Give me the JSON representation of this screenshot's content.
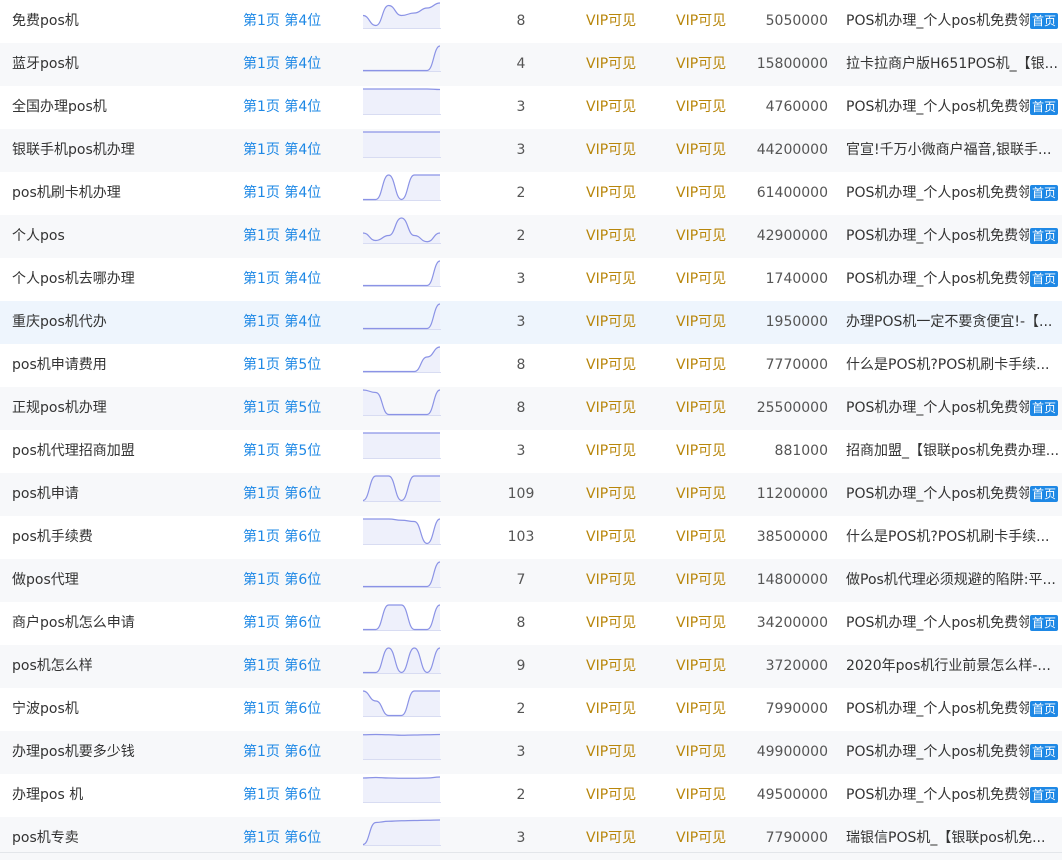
{
  "colors": {
    "rank_link": "#1e88e5",
    "vip_text": "#b8860b",
    "badge_bg": "#1e88e5",
    "trend_line": "#8b93e6",
    "trend_fill": "#eef0fb"
  },
  "rows": [
    {
      "keyword": "免费pos机",
      "rank": "第1页 第4位",
      "trend": [
        0.5,
        0.1,
        0.9,
        0.5,
        0.6,
        0.8,
        1.0
      ],
      "index": "8",
      "vip1": "VIP可见",
      "vip2": "VIP可见",
      "volume": "5050000",
      "title": "POS机办理_个人pos机免费领",
      "badge": "首页"
    },
    {
      "keyword": "蓝牙pos机",
      "rank": "第1页 第4位",
      "trend": [
        0.02,
        0.02,
        0.02,
        0.02,
        0.02,
        0.02,
        1.0
      ],
      "index": "4",
      "vip1": "VIP可见",
      "vip2": "VIP可见",
      "volume": "15800000",
      "title": "拉卡拉商户版H651POS机_【银...",
      "badge": ""
    },
    {
      "keyword": "全国办理pos机",
      "rank": "第1页 第4位",
      "trend": [
        1,
        1,
        1,
        1,
        1,
        1,
        0.98
      ],
      "index": "3",
      "vip1": "VIP可见",
      "vip2": "VIP可见",
      "volume": "4760000",
      "title": "POS机办理_个人pos机免费领",
      "badge": "首页"
    },
    {
      "keyword": "银联手机pos机办理",
      "rank": "第1页 第4位",
      "trend": [
        1,
        1,
        1,
        1,
        1,
        1,
        1
      ],
      "index": "3",
      "vip1": "VIP可见",
      "vip2": "VIP可见",
      "volume": "44200000",
      "title": "官宣!千万小微商户福音,银联手...",
      "badge": ""
    },
    {
      "keyword": "pos机刷卡机办理",
      "rank": "第1页 第4位",
      "trend": [
        0.02,
        0.02,
        1,
        0.02,
        1,
        1,
        1
      ],
      "index": "2",
      "vip1": "VIP可见",
      "vip2": "VIP可见",
      "volume": "61400000",
      "title": "POS机办理_个人pos机免费领",
      "badge": "首页"
    },
    {
      "keyword": "个人pos",
      "rank": "第1页 第4位",
      "trend": [
        0.4,
        0.1,
        0.3,
        1,
        0.3,
        0.05,
        0.4
      ],
      "index": "2",
      "vip1": "VIP可见",
      "vip2": "VIP可见",
      "volume": "42900000",
      "title": "POS机办理_个人pos机免费领",
      "badge": "首页"
    },
    {
      "keyword": "个人pos机去哪办理",
      "rank": "第1页 第4位",
      "trend": [
        0.02,
        0.02,
        0.02,
        0.02,
        0.02,
        0.02,
        1
      ],
      "index": "3",
      "vip1": "VIP可见",
      "vip2": "VIP可见",
      "volume": "1740000",
      "title": "POS机办理_个人pos机免费领",
      "badge": "首页"
    },
    {
      "keyword": "重庆pos机代办",
      "rank": "第1页 第4位",
      "trend": [
        0.02,
        0.02,
        0.02,
        0.02,
        0.02,
        0.02,
        1
      ],
      "index": "3",
      "vip1": "VIP可见",
      "vip2": "VIP可见",
      "volume": "1950000",
      "title": "办理POS机一定不要贪便宜!-【...",
      "badge": ""
    },
    {
      "keyword": "pos机申请费用",
      "rank": "第1页 第5位",
      "trend": [
        0.02,
        0.02,
        0.02,
        0.02,
        0.02,
        0.6,
        1
      ],
      "index": "8",
      "vip1": "VIP可见",
      "vip2": "VIP可见",
      "volume": "7770000",
      "title": "什么是POS机?POS机刷卡手续...",
      "badge": ""
    },
    {
      "keyword": "正规pos机办理",
      "rank": "第1页 第5位",
      "trend": [
        1,
        0.9,
        0.02,
        0.02,
        0.02,
        0.02,
        1
      ],
      "index": "8",
      "vip1": "VIP可见",
      "vip2": "VIP可见",
      "volume": "25500000",
      "title": "POS机办理_个人pos机免费领",
      "badge": "首页"
    },
    {
      "keyword": "pos机代理招商加盟",
      "rank": "第1页 第5位",
      "trend": [
        1,
        1,
        1,
        1,
        1,
        1,
        1
      ],
      "index": "3",
      "vip1": "VIP可见",
      "vip2": "VIP可见",
      "volume": "881000",
      "title": "招商加盟_【银联pos机免费办理...",
      "badge": ""
    },
    {
      "keyword": "pos机申请",
      "rank": "第1页 第6位",
      "trend": [
        0.02,
        1,
        1,
        0.02,
        1,
        1,
        1
      ],
      "index": "109",
      "vip1": "VIP可见",
      "vip2": "VIP可见",
      "volume": "11200000",
      "title": "POS机办理_个人pos机免费领",
      "badge": "首页"
    },
    {
      "keyword": "pos机手续费",
      "rank": "第1页 第6位",
      "trend": [
        1,
        1,
        1,
        0.95,
        0.9,
        0.02,
        1
      ],
      "index": "103",
      "vip1": "VIP可见",
      "vip2": "VIP可见",
      "volume": "38500000",
      "title": "什么是POS机?POS机刷卡手续...",
      "badge": ""
    },
    {
      "keyword": "做pos代理",
      "rank": "第1页 第6位",
      "trend": [
        0.02,
        0.02,
        0.02,
        0.02,
        0.02,
        0.02,
        1
      ],
      "index": "7",
      "vip1": "VIP可见",
      "vip2": "VIP可见",
      "volume": "14800000",
      "title": "做Pos机代理必须规避的陷阱:平...",
      "badge": ""
    },
    {
      "keyword": "商户pos机怎么申请",
      "rank": "第1页 第6位",
      "trend": [
        0.02,
        0.02,
        1,
        1,
        0.02,
        0.02,
        1
      ],
      "index": "8",
      "vip1": "VIP可见",
      "vip2": "VIP可见",
      "volume": "34200000",
      "title": "POS机办理_个人pos机免费领",
      "badge": "首页"
    },
    {
      "keyword": "pos机怎么样",
      "rank": "第1页 第6位",
      "trend": [
        0.02,
        0.02,
        1,
        0.02,
        1,
        0.02,
        1
      ],
      "index": "9",
      "vip1": "VIP可见",
      "vip2": "VIP可见",
      "volume": "3720000",
      "title": "2020年pos机行业前景怎么样-...",
      "badge": ""
    },
    {
      "keyword": "宁波pos机",
      "rank": "第1页 第6位",
      "trend": [
        1,
        0.6,
        0.02,
        0.02,
        1,
        1,
        1
      ],
      "index": "2",
      "vip1": "VIP可见",
      "vip2": "VIP可见",
      "volume": "7990000",
      "title": "POS机办理_个人pos机免费领",
      "badge": "首页"
    },
    {
      "keyword": "办理pos机要多少钱",
      "rank": "第1页 第6位",
      "trend": [
        0.97,
        0.98,
        0.97,
        0.95,
        0.96,
        0.97,
        0.98
      ],
      "index": "3",
      "vip1": "VIP可见",
      "vip2": "VIP可见",
      "volume": "49900000",
      "title": "POS机办理_个人pos机免费领",
      "badge": "首页"
    },
    {
      "keyword": "办理pos 机",
      "rank": "第1页 第6位",
      "trend": [
        0.96,
        0.98,
        0.96,
        0.95,
        0.95,
        0.96,
        1
      ],
      "index": "2",
      "vip1": "VIP可见",
      "vip2": "VIP可见",
      "volume": "49500000",
      "title": "POS机办理_个人pos机免费领",
      "badge": "首页"
    },
    {
      "keyword": "pos机专卖",
      "rank": "第1页 第6位",
      "trend": [
        0.02,
        0.9,
        0.95,
        0.97,
        0.98,
        0.99,
        1
      ],
      "index": "3",
      "vip1": "VIP可见",
      "vip2": "VIP可见",
      "volume": "7790000",
      "title": "瑞银信POS机_【银联pos机免...",
      "badge": ""
    }
  ]
}
